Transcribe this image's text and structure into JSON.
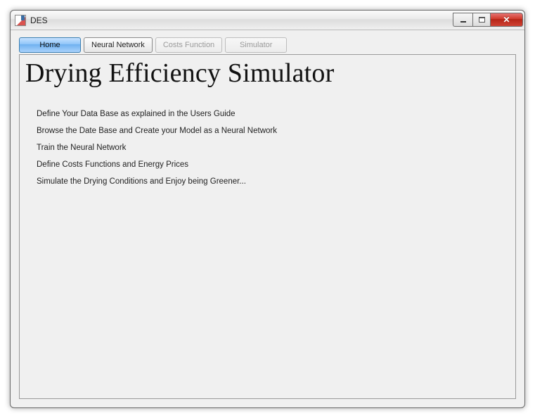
{
  "window": {
    "title": "DES"
  },
  "tabs": [
    {
      "label": "Home",
      "state": "active"
    },
    {
      "label": "Neural Network",
      "state": "enabled"
    },
    {
      "label": "Costs Function",
      "state": "disabled"
    },
    {
      "label": "Simulator",
      "state": "disabled"
    }
  ],
  "main": {
    "heading": "Drying Efficiency Simulator",
    "steps": [
      "Define Your Data Base as explained in the Users Guide",
      "Browse the Date Base and Create your Model as a Neural Network",
      "Train the Neural Network",
      "Define Costs Functions and Energy Prices",
      "Simulate the Drying Conditions and Enjoy being Greener..."
    ]
  }
}
